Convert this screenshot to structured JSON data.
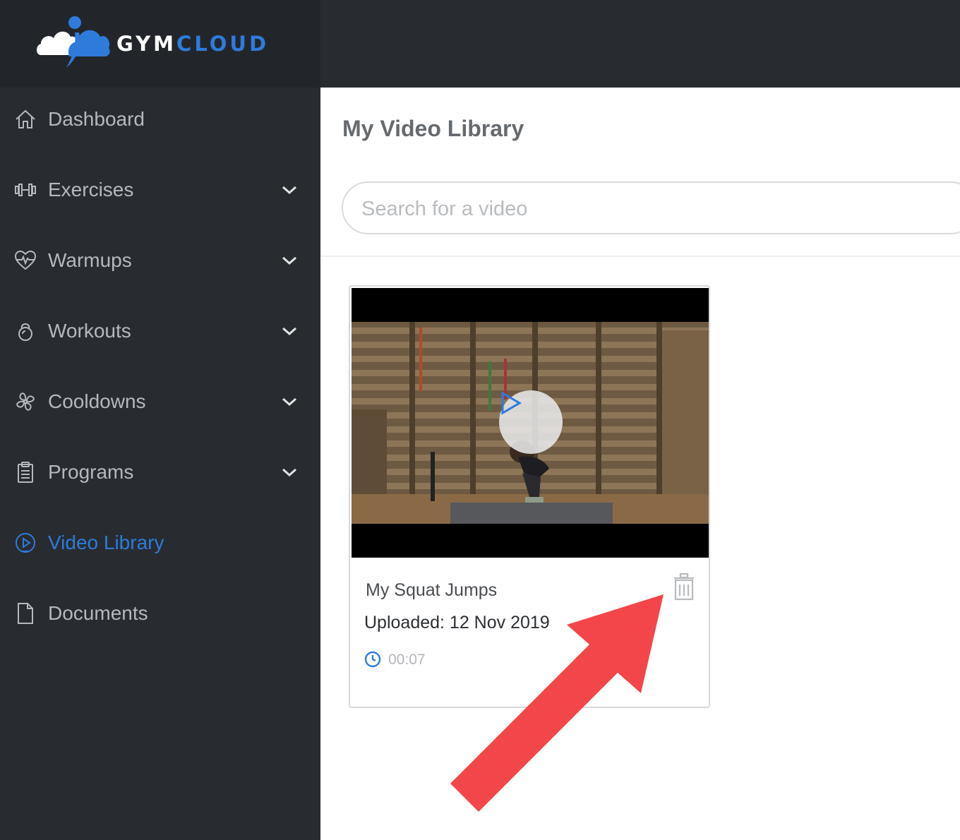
{
  "brand": {
    "name_part1": "GYM",
    "name_part2": "CLOUD",
    "accent_color": "#2e7bdc"
  },
  "sidebar": {
    "items": [
      {
        "label": "Dashboard",
        "icon": "home-icon",
        "has_chevron": false,
        "active": false
      },
      {
        "label": "Exercises",
        "icon": "dumbbell-icon",
        "has_chevron": true,
        "active": false
      },
      {
        "label": "Warmups",
        "icon": "heartbeat-icon",
        "has_chevron": true,
        "active": false
      },
      {
        "label": "Workouts",
        "icon": "kettlebell-icon",
        "has_chevron": true,
        "active": false
      },
      {
        "label": "Cooldowns",
        "icon": "fan-icon",
        "has_chevron": true,
        "active": false
      },
      {
        "label": "Programs",
        "icon": "clipboard-icon",
        "has_chevron": true,
        "active": false
      },
      {
        "label": "Video Library",
        "icon": "play-circle-icon",
        "has_chevron": false,
        "active": true
      },
      {
        "label": "Documents",
        "icon": "document-icon",
        "has_chevron": false,
        "active": false
      }
    ]
  },
  "main": {
    "title": "My Video Library",
    "search": {
      "placeholder": "Search for a video",
      "value": ""
    }
  },
  "videos": [
    {
      "title": "My Squat Jumps",
      "uploaded": "Uploaded: 12 Nov 2019",
      "duration": "00:07"
    }
  ],
  "colors": {
    "sidebar_bg": "#282c30",
    "active": "#2e7bdc",
    "annotation_arrow": "#f2464b"
  }
}
